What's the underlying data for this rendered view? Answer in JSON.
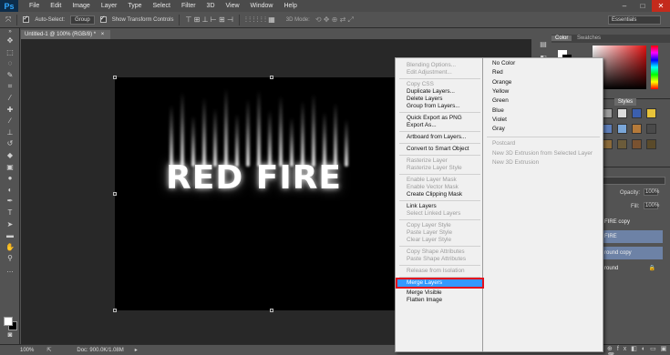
{
  "app": {
    "logo": "Ps"
  },
  "menubar": [
    "File",
    "Edit",
    "Image",
    "Layer",
    "Type",
    "Select",
    "Filter",
    "3D",
    "View",
    "Window",
    "Help"
  ],
  "options": {
    "auto_select_label": "Auto-Select:",
    "auto_select_target": "Group",
    "show_transform_label": "Show Transform Controls",
    "mode_3d_label": "3D Mode:",
    "workspace": "Essentials"
  },
  "document": {
    "tab_title": "Untitled-1 @ 100% (RGB/8) *",
    "canvas_text": "RED FIRE"
  },
  "status": {
    "zoom": "100%",
    "doc_info": "Doc: 900.0K/1.08M"
  },
  "color_panel": {
    "tabs": [
      "Color",
      "Swatches"
    ]
  },
  "styles_panel": {
    "tab": "Styles"
  },
  "layers_panel": {
    "opacity_label": "Opacity:",
    "opacity_value": "100%",
    "fill_label": "Fill:",
    "fill_value": "100%",
    "layers": [
      "FIRE copy",
      "FIRE",
      "round copy",
      "round"
    ]
  },
  "context_menu": {
    "items": [
      {
        "label": "Blending Options...",
        "enabled": false
      },
      {
        "label": "Edit Adjustment...",
        "enabled": false
      },
      {
        "sep": true
      },
      {
        "label": "Copy CSS",
        "enabled": false
      },
      {
        "label": "Duplicate Layers...",
        "enabled": true
      },
      {
        "label": "Delete Layers",
        "enabled": true
      },
      {
        "label": "Group from Layers...",
        "enabled": true
      },
      {
        "sep": true
      },
      {
        "label": "Quick Export as PNG",
        "enabled": true
      },
      {
        "label": "Export As...",
        "enabled": true
      },
      {
        "sep": true
      },
      {
        "label": "Artboard from Layers...",
        "enabled": true
      },
      {
        "sep": true
      },
      {
        "label": "Convert to Smart Object",
        "enabled": true
      },
      {
        "sep": true
      },
      {
        "label": "Rasterize Layer",
        "enabled": false
      },
      {
        "label": "Rasterize Layer Style",
        "enabled": false
      },
      {
        "sep": true
      },
      {
        "label": "Enable Layer Mask",
        "enabled": false
      },
      {
        "label": "Enable Vector Mask",
        "enabled": false
      },
      {
        "label": "Create Clipping Mask",
        "enabled": true
      },
      {
        "sep": true
      },
      {
        "label": "Link Layers",
        "enabled": true
      },
      {
        "label": "Select Linked Layers",
        "enabled": false
      },
      {
        "sep": true
      },
      {
        "label": "Copy Layer Style",
        "enabled": false
      },
      {
        "label": "Paste Layer Style",
        "enabled": false
      },
      {
        "label": "Clear Layer Style",
        "enabled": false
      },
      {
        "sep": true
      },
      {
        "label": "Copy Shape Attributes",
        "enabled": false
      },
      {
        "label": "Paste Shape Attributes",
        "enabled": false
      },
      {
        "sep": true
      },
      {
        "label": "Release from Isolation",
        "enabled": false
      },
      {
        "sep": true
      },
      {
        "label": "Merge Layers",
        "enabled": true,
        "highlighted": true
      },
      {
        "label": "Merge Visible",
        "enabled": true
      },
      {
        "label": "Flatten Image",
        "enabled": true
      }
    ]
  },
  "color_submenu": {
    "items": [
      {
        "label": "No Color",
        "enabled": true
      },
      {
        "label": "Red",
        "enabled": true
      },
      {
        "label": "Orange",
        "enabled": true
      },
      {
        "label": "Yellow",
        "enabled": true
      },
      {
        "label": "Green",
        "enabled": true
      },
      {
        "label": "Blue",
        "enabled": true
      },
      {
        "label": "Violet",
        "enabled": true
      },
      {
        "label": "Gray",
        "enabled": true
      },
      {
        "sep": true
      },
      {
        "label": "Postcard",
        "enabled": false
      },
      {
        "label": "New 3D Extrusion from Selected Layer",
        "enabled": false
      },
      {
        "label": "New 3D Extrusion",
        "enabled": false
      }
    ]
  },
  "colors": {
    "highlight": "#3399ff",
    "highlight_border": "#e3101d",
    "selected_layer": "#6d82a6"
  }
}
